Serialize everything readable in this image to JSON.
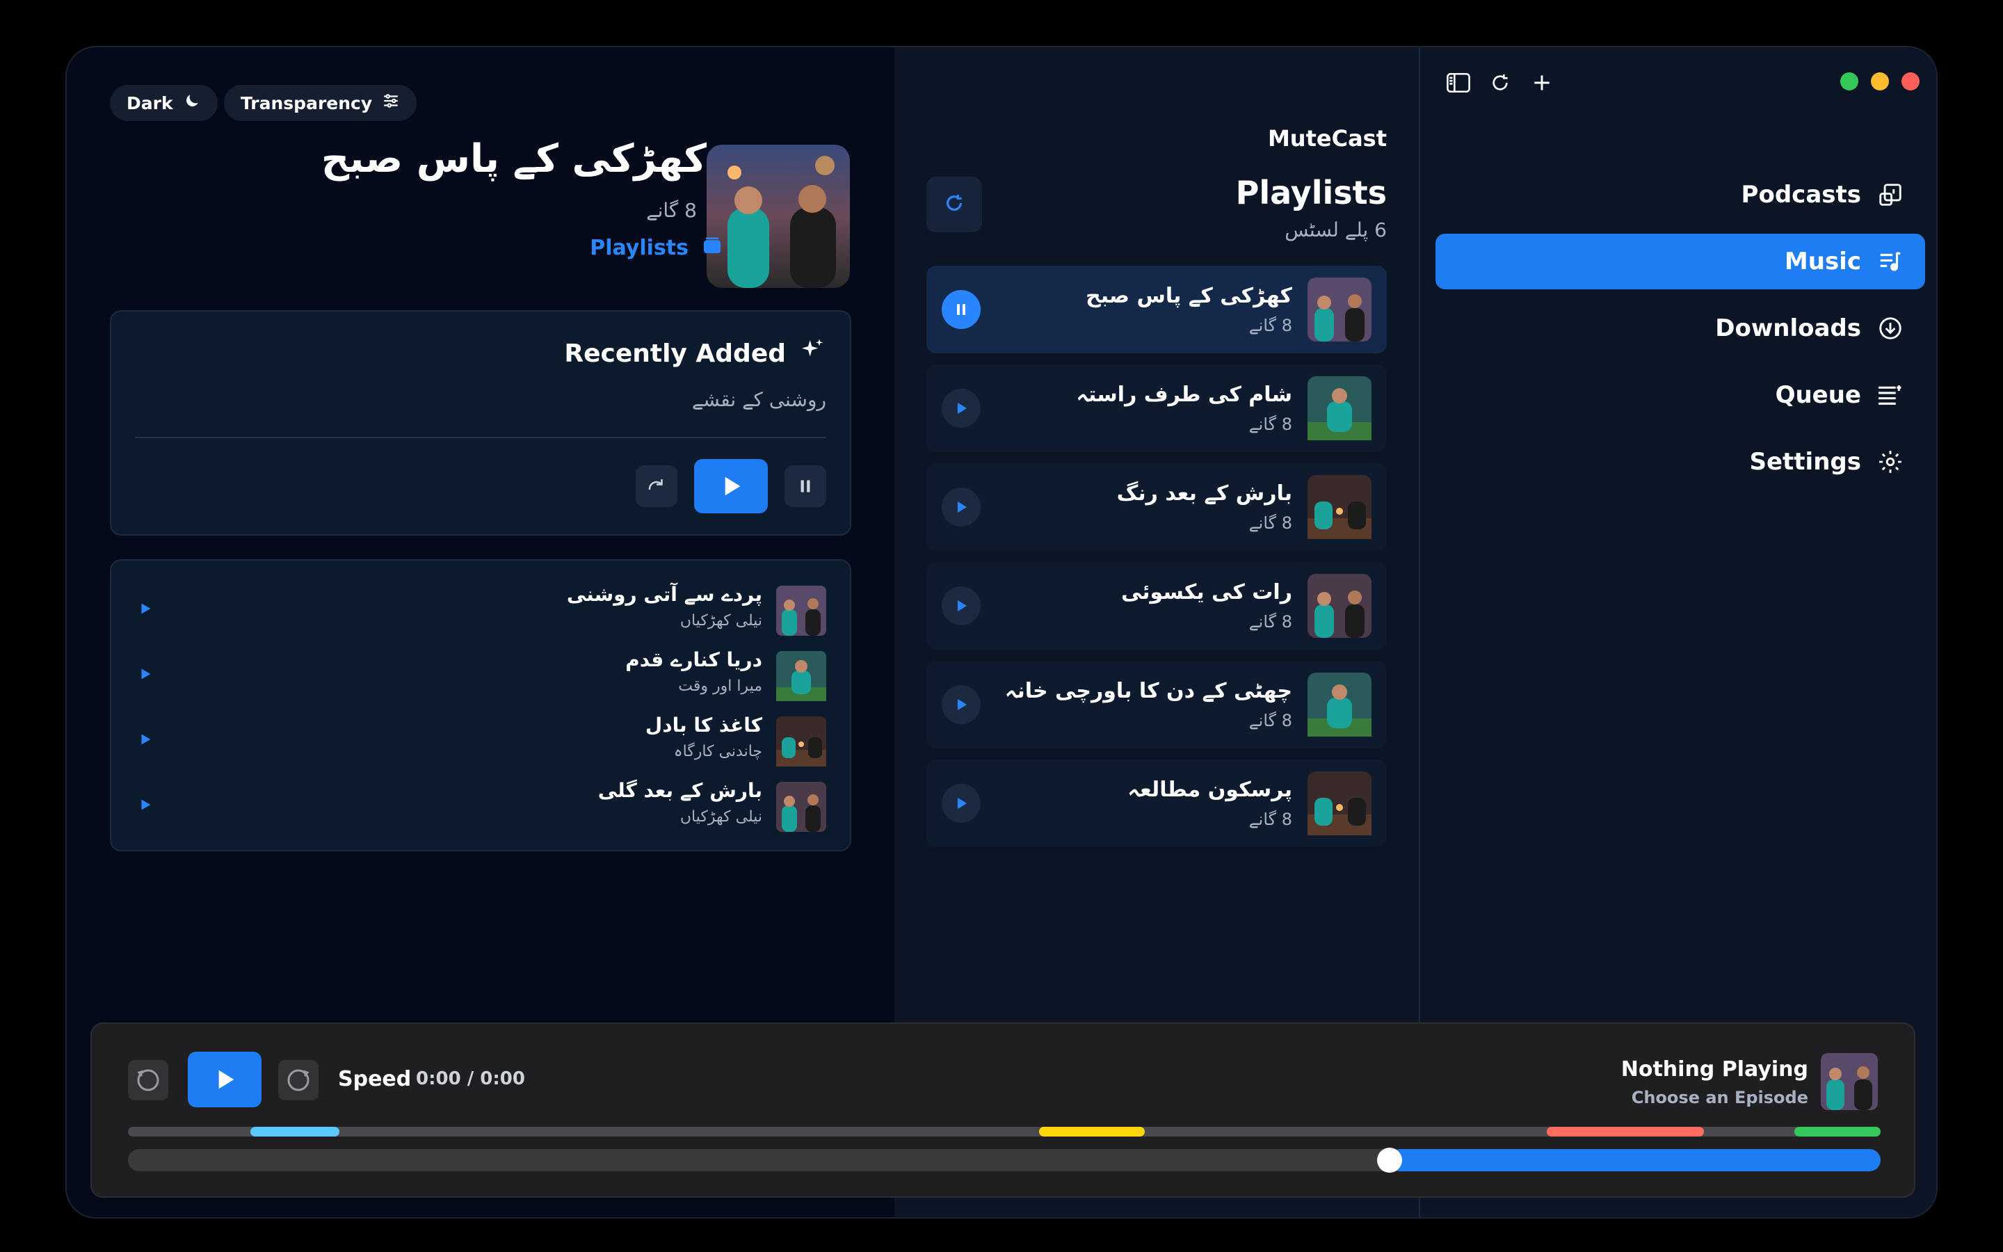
{
  "window": {
    "traffic_lights": [
      "#34c759",
      "#febc2e",
      "#ff5f57"
    ]
  },
  "toolbar": {
    "icons": [
      "sidebar-toggle-icon",
      "refresh-icon",
      "plus-icon"
    ]
  },
  "sidebar": {
    "items": [
      {
        "label": "Podcasts",
        "icon": "podcasts-icon",
        "active": false
      },
      {
        "label": "Music",
        "icon": "music-note-list-icon",
        "active": true
      },
      {
        "label": "Downloads",
        "icon": "download-circle-icon",
        "active": false
      },
      {
        "label": "Queue",
        "icon": "queue-list-icon",
        "active": false
      },
      {
        "label": "Settings",
        "icon": "gear-icon",
        "active": false
      }
    ],
    "accent": "#1e7df2"
  },
  "playlists_panel": {
    "app_name": "MuteCast",
    "title": "Playlists",
    "count": "6 پلے لسٹس",
    "items": [
      {
        "name": "کھڑکی کے پاس صبح",
        "count": "8 گانے",
        "playing": true
      },
      {
        "name": "شام کی طرف راستہ",
        "count": "8 گانے",
        "playing": false
      },
      {
        "name": "بارش کے بعد رنگ",
        "count": "8 گانے",
        "playing": false
      },
      {
        "name": "رات کی یکسوئی",
        "count": "8 گانے",
        "playing": false
      },
      {
        "name": "چھٹی کے دن کا باورچی خانہ",
        "count": "8 گانے",
        "playing": false
      },
      {
        "name": "پرسکون مطالعہ",
        "count": "8 گانے",
        "playing": false
      }
    ]
  },
  "detail": {
    "chips": [
      {
        "label": "Dark",
        "icon": "moon-icon"
      },
      {
        "label": "Transparency",
        "icon": "sliders-icon"
      }
    ],
    "title": "کھڑکی کے پاس صبح",
    "subtitle": "8 گانے",
    "link": "Playlists",
    "recent": {
      "title": "Recently Added",
      "subtitle": "روشنی کے نقشے"
    },
    "tracks": [
      {
        "title": "پردے سے آتی روشنی",
        "artist": "نیلی کھڑکیاں"
      },
      {
        "title": "دریا کنارے قدم",
        "artist": "میرا اور وقت"
      },
      {
        "title": "کاغذ کا بادل",
        "artist": "چاندنی کارگاہ"
      },
      {
        "title": "بارش کے بعد گلی",
        "artist": "نیلی کھڑکیاں"
      }
    ]
  },
  "player": {
    "speed_label": "Speed",
    "time": "0:00 / 0:00",
    "now_playing_title": "Nothing Playing",
    "now_playing_sub": "Choose an Episode",
    "progress": 0.28,
    "chapter_colors": [
      "#5ac8fa",
      "#ffd60a",
      "#ff6b5e",
      "#34c759"
    ]
  }
}
